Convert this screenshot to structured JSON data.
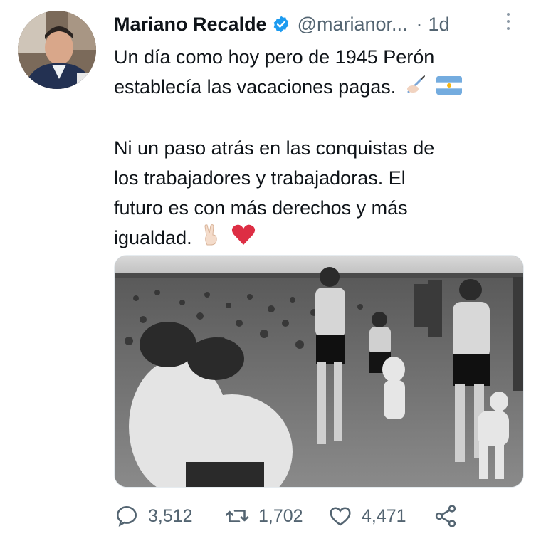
{
  "tweet": {
    "author_name": "Mariano Recalde",
    "handle": "@marianor...",
    "separator": "·",
    "time": "1d",
    "text_line1": "Un día como hoy pero de 1945 Perón",
    "text_line2": "establecía las vacaciones pagas.",
    "text_line3": "Ni un paso atrás en las conquistas de",
    "text_line4": "los trabajadores y trabajadoras. El",
    "text_line5": "futuro es con más derechos y más",
    "text_line6": "igualdad.",
    "replies": "3,512",
    "retweets": "1,702",
    "likes": "4,471"
  },
  "icons": {
    "verified": "verified-badge-icon",
    "more": "more-options-icon",
    "reply": "reply-icon",
    "retweet": "retweet-icon",
    "like": "heart-icon",
    "share": "share-icon"
  },
  "colors": {
    "accent": "#1d9bf0",
    "text": "#0f1419",
    "secondary": "#536471",
    "heart": "#e0245e"
  }
}
